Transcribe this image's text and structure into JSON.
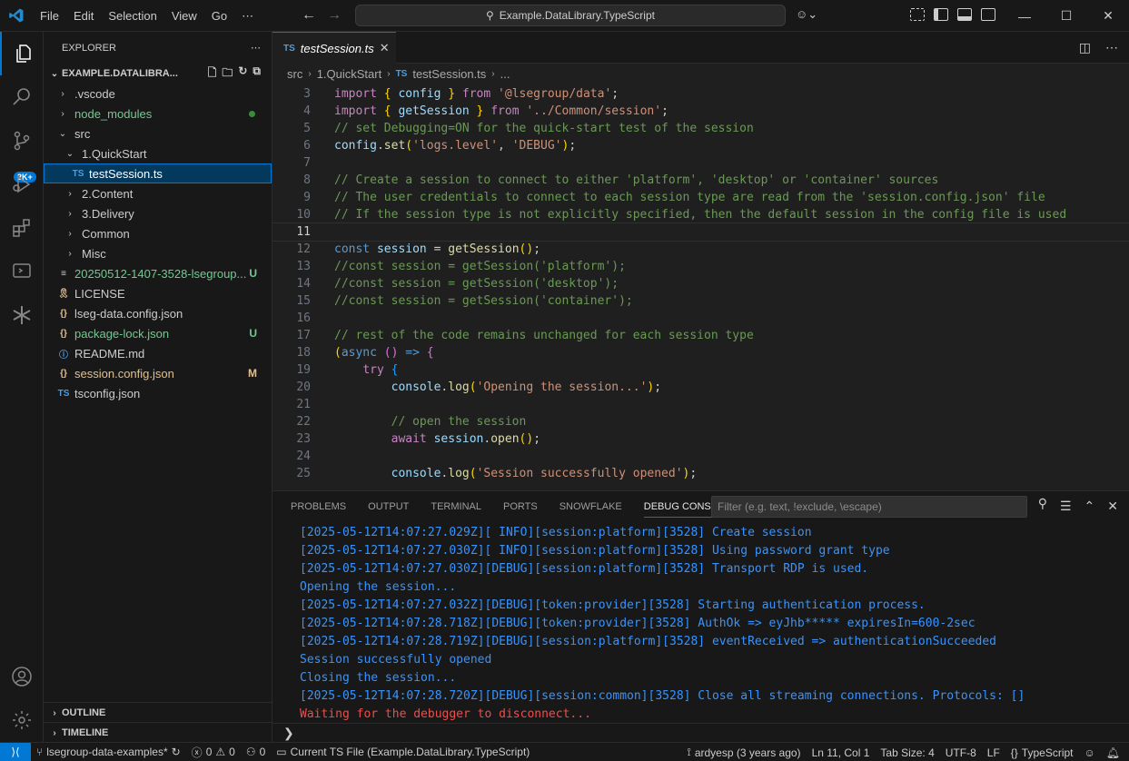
{
  "titlebar": {
    "menu": [
      "File",
      "Edit",
      "Selection",
      "View",
      "Go",
      "⋯"
    ],
    "search": "Example.DataLibrary.TypeScript"
  },
  "activity": {
    "badge": "2K+"
  },
  "sidebar": {
    "title": "EXPLORER",
    "root": "EXAMPLE.DATALIBRA...",
    "tree": [
      {
        "label": ".vscode",
        "depth": 1,
        "kind": "folder",
        "open": false,
        "color": "#cccccc"
      },
      {
        "label": "node_modules",
        "depth": 1,
        "kind": "folder",
        "open": false,
        "color": "#73c991",
        "dot": true
      },
      {
        "label": "src",
        "depth": 1,
        "kind": "folder",
        "open": true,
        "color": "#cccccc"
      },
      {
        "label": "1.QuickStart",
        "depth": 2,
        "kind": "folder",
        "open": true,
        "color": "#cccccc"
      },
      {
        "label": "testSession.ts",
        "depth": 3,
        "kind": "ts",
        "color": "#ffffff",
        "selected": true
      },
      {
        "label": "2.Content",
        "depth": 2,
        "kind": "folder",
        "open": false,
        "color": "#cccccc"
      },
      {
        "label": "3.Delivery",
        "depth": 2,
        "kind": "folder",
        "open": false,
        "color": "#cccccc"
      },
      {
        "label": "Common",
        "depth": 2,
        "kind": "folder",
        "open": false,
        "color": "#cccccc"
      },
      {
        "label": "Misc",
        "depth": 2,
        "kind": "folder",
        "open": false,
        "color": "#cccccc"
      },
      {
        "label": "20250512-1407-3528-lsegroup...",
        "depth": 1,
        "kind": "log",
        "color": "#73c991",
        "deco": "U",
        "decoColor": "#73c991"
      },
      {
        "label": "LICENSE",
        "depth": 1,
        "kind": "license",
        "color": "#cccccc"
      },
      {
        "label": "lseg-data.config.json",
        "depth": 1,
        "kind": "json",
        "color": "#cccccc"
      },
      {
        "label": "package-lock.json",
        "depth": 1,
        "kind": "json",
        "color": "#73c991",
        "deco": "U",
        "decoColor": "#73c991"
      },
      {
        "label": "README.md",
        "depth": 1,
        "kind": "info",
        "color": "#cccccc"
      },
      {
        "label": "session.config.json",
        "depth": 1,
        "kind": "json",
        "color": "#e2c08d",
        "deco": "M",
        "decoColor": "#e2c08d"
      },
      {
        "label": "tsconfig.json",
        "depth": 1,
        "kind": "tsconfig",
        "color": "#cccccc"
      }
    ],
    "outline": "OUTLINE",
    "timeline": "TIMELINE"
  },
  "editor": {
    "tab_label": "testSession.ts",
    "breadcrumb": [
      "src",
      "1.QuickStart",
      "testSession.ts",
      "..."
    ],
    "current_line": 11,
    "lines": [
      {
        "n": "3",
        "parts": [
          [
            "kw",
            "import "
          ],
          [
            "brk",
            "{ "
          ],
          [
            "var",
            "config"
          ],
          [
            "brk",
            " }"
          ],
          [
            "kw",
            " from "
          ],
          [
            "str",
            "'@lsegroup/data'"
          ],
          [
            "pun",
            ";"
          ]
        ]
      },
      {
        "n": "4",
        "parts": [
          [
            "kw",
            "import "
          ],
          [
            "brk",
            "{ "
          ],
          [
            "var",
            "getSession"
          ],
          [
            "brk",
            " }"
          ],
          [
            "kw",
            " from "
          ],
          [
            "str",
            "'../Common/session'"
          ],
          [
            "pun",
            ";"
          ]
        ]
      },
      {
        "n": "5",
        "parts": [
          [
            "com",
            "// set Debugging=ON for the quick-start test of the session"
          ]
        ]
      },
      {
        "n": "6",
        "parts": [
          [
            "var",
            "config"
          ],
          [
            "pun",
            "."
          ],
          [
            "fn",
            "set"
          ],
          [
            "brk",
            "("
          ],
          [
            "str",
            "'logs.level'"
          ],
          [
            "pun",
            ", "
          ],
          [
            "str",
            "'DEBUG'"
          ],
          [
            "brk",
            ")"
          ],
          [
            "pun",
            ";"
          ]
        ]
      },
      {
        "n": "7",
        "parts": []
      },
      {
        "n": "8",
        "parts": [
          [
            "com",
            "// Create a session to connect to either 'platform', 'desktop' or 'container' sources"
          ]
        ]
      },
      {
        "n": "9",
        "parts": [
          [
            "com",
            "// The user credentials to connect to each session type are read from the 'session.config.json' file"
          ]
        ]
      },
      {
        "n": "10",
        "parts": [
          [
            "com",
            "// If the session type is not explicitly specified, then the default session in the config file is used"
          ]
        ]
      },
      {
        "n": "11",
        "parts": []
      },
      {
        "n": "12",
        "parts": [
          [
            "kw2",
            "const "
          ],
          [
            "var",
            "session"
          ],
          [
            "pun",
            " = "
          ],
          [
            "fn",
            "getSession"
          ],
          [
            "brk",
            "()"
          ],
          [
            "pun",
            ";"
          ]
        ]
      },
      {
        "n": "13",
        "parts": [
          [
            "com",
            "//const session = getSession('platform');"
          ]
        ]
      },
      {
        "n": "14",
        "parts": [
          [
            "com",
            "//const session = getSession('desktop');"
          ]
        ]
      },
      {
        "n": "15",
        "parts": [
          [
            "com",
            "//const session = getSession('container');"
          ]
        ]
      },
      {
        "n": "16",
        "parts": []
      },
      {
        "n": "17",
        "parts": [
          [
            "com",
            "// rest of the code remains unchanged for each session type"
          ]
        ]
      },
      {
        "n": "18",
        "parts": [
          [
            "brk",
            "("
          ],
          [
            "kw2",
            "async "
          ],
          [
            "brk2",
            "()"
          ],
          [
            "kw2",
            " => "
          ],
          [
            "brk2",
            "{"
          ]
        ]
      },
      {
        "n": "19",
        "parts": [
          [
            "pun",
            "    "
          ],
          [
            "kw",
            "try "
          ],
          [
            "brk3",
            "{"
          ]
        ]
      },
      {
        "n": "20",
        "parts": [
          [
            "pun",
            "        "
          ],
          [
            "var",
            "console"
          ],
          [
            "pun",
            "."
          ],
          [
            "fn",
            "log"
          ],
          [
            "brk",
            "("
          ],
          [
            "str",
            "'Opening the session...'"
          ],
          [
            "brk",
            ")"
          ],
          [
            "pun",
            ";"
          ]
        ]
      },
      {
        "n": "21",
        "parts": []
      },
      {
        "n": "22",
        "parts": [
          [
            "pun",
            "        "
          ],
          [
            "com",
            "// open the session"
          ]
        ]
      },
      {
        "n": "23",
        "parts": [
          [
            "pun",
            "        "
          ],
          [
            "kw",
            "await "
          ],
          [
            "var",
            "session"
          ],
          [
            "pun",
            "."
          ],
          [
            "fn",
            "open"
          ],
          [
            "brk",
            "()"
          ],
          [
            "pun",
            ";"
          ]
        ]
      },
      {
        "n": "24",
        "parts": []
      },
      {
        "n": "25",
        "parts": [
          [
            "pun",
            "        "
          ],
          [
            "var",
            "console"
          ],
          [
            "pun",
            "."
          ],
          [
            "fn",
            "log"
          ],
          [
            "brk",
            "("
          ],
          [
            "str",
            "'Session successfully opened'"
          ],
          [
            "brk",
            ")"
          ],
          [
            "pun",
            ";"
          ]
        ]
      }
    ]
  },
  "panel": {
    "tabs": [
      "PROBLEMS",
      "OUTPUT",
      "TERMINAL",
      "PORTS",
      "SNOWFLAKE",
      "DEBUG CONSOLE"
    ],
    "active_tab": "DEBUG CONSOLE",
    "filter_placeholder": "Filter (e.g. text, !exclude, \\escape)",
    "console": [
      {
        "text": "[2025-05-12T14:07:27.029Z][ INFO][session:platform][3528] Create session"
      },
      {
        "text": "[2025-05-12T14:07:27.030Z][ INFO][session:platform][3528] Using password grant type"
      },
      {
        "text": "[2025-05-12T14:07:27.030Z][DEBUG][session:platform][3528] Transport RDP is used."
      },
      {
        "text": "Opening the session..."
      },
      {
        "text": "[2025-05-12T14:07:27.032Z][DEBUG][token:provider][3528] Starting authentication process."
      },
      {
        "text": "[2025-05-12T14:07:28.718Z][DEBUG][token:provider][3528] AuthOk => eyJhb***** expiresIn=600-2sec"
      },
      {
        "text": "[2025-05-12T14:07:28.719Z][DEBUG][session:platform][3528] eventReceived => authenticationSucceeded"
      },
      {
        "text": "Session successfully opened"
      },
      {
        "text": "Closing the session..."
      },
      {
        "text": "[2025-05-12T14:07:28.720Z][DEBUG][session:common][3528] Close all streaming connections. Protocols: []"
      },
      {
        "text": "Waiting for the debugger to disconnect...",
        "error": true
      }
    ],
    "prompt": "❯"
  },
  "status": {
    "branch": "lsegroup-data-examples*",
    "errors": "0",
    "warnings": "0",
    "ports": "0",
    "ts_file": "Current TS File (Example.DataLibrary.TypeScript)",
    "blame": "ardyesp (3 years ago)",
    "position": "Ln 11, Col 1",
    "tab_size": "Tab Size: 4",
    "encoding": "UTF-8",
    "eol": "LF",
    "language": "TypeScript"
  }
}
